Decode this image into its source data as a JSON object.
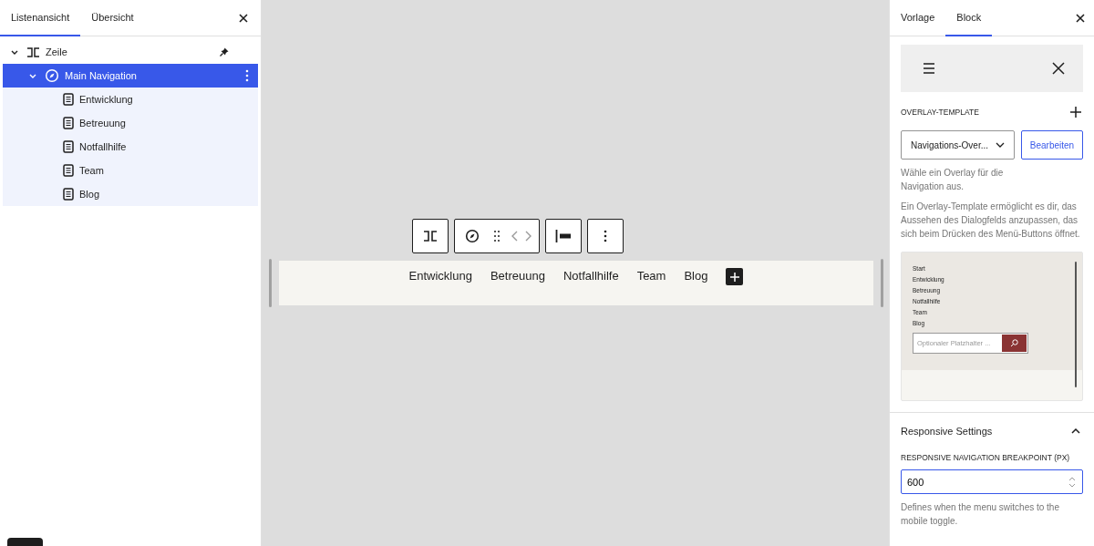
{
  "left_panel": {
    "tabs": [
      {
        "label": "Listenansicht",
        "selected": true
      },
      {
        "label": "Übersicht",
        "selected": false
      }
    ],
    "tree": [
      {
        "label": "Zeile",
        "kind": "row",
        "expanded": true,
        "selected": false,
        "pinned": true,
        "children": [
          {
            "label": "Main Navigation",
            "kind": "navigation",
            "expanded": true,
            "selected": true,
            "children": [
              {
                "label": "Entwicklung",
                "kind": "page",
                "selected": false
              },
              {
                "label": "Betreuung",
                "kind": "page",
                "selected": false
              },
              {
                "label": "Notfallhilfe",
                "kind": "page",
                "selected": false
              },
              {
                "label": "Team",
                "kind": "page",
                "selected": false
              },
              {
                "label": "Blog",
                "kind": "page",
                "selected": false
              }
            ]
          }
        ]
      }
    ]
  },
  "canvas": {
    "nav_items": [
      "Entwicklung",
      "Betreuung",
      "Notfallhilfe",
      "Team",
      "Blog"
    ]
  },
  "right_panel": {
    "tabs": [
      {
        "label": "Vorlage",
        "selected": false
      },
      {
        "label": "Block",
        "selected": true
      }
    ],
    "overlay_template": {
      "heading": "OVERLAY-TEMPLATE",
      "select_value": "Navigations-Over...",
      "edit_button": "Bearbeiten",
      "help": "Wähle ein Overlay für die Navigation aus.",
      "description": "Ein Overlay-Template ermöglicht es dir, das Aussehen des Dialogfelds anzupassen, das sich beim Drücken des Menü-Buttons öffnet.",
      "preview_links": [
        "Start",
        "Entwicklung",
        "Betreuung",
        "Notfallhilfe",
        "Team",
        "Blog"
      ],
      "preview_search_placeholder": "Optionaler Platzhalter ..."
    },
    "responsive": {
      "title": "Responsive Settings",
      "expanded": true,
      "field_label": "RESPONSIVE NAVIGATION BREAKPOINT (PX)",
      "value": "600",
      "help": "Defines when the menu switches to the mobile toggle."
    }
  }
}
